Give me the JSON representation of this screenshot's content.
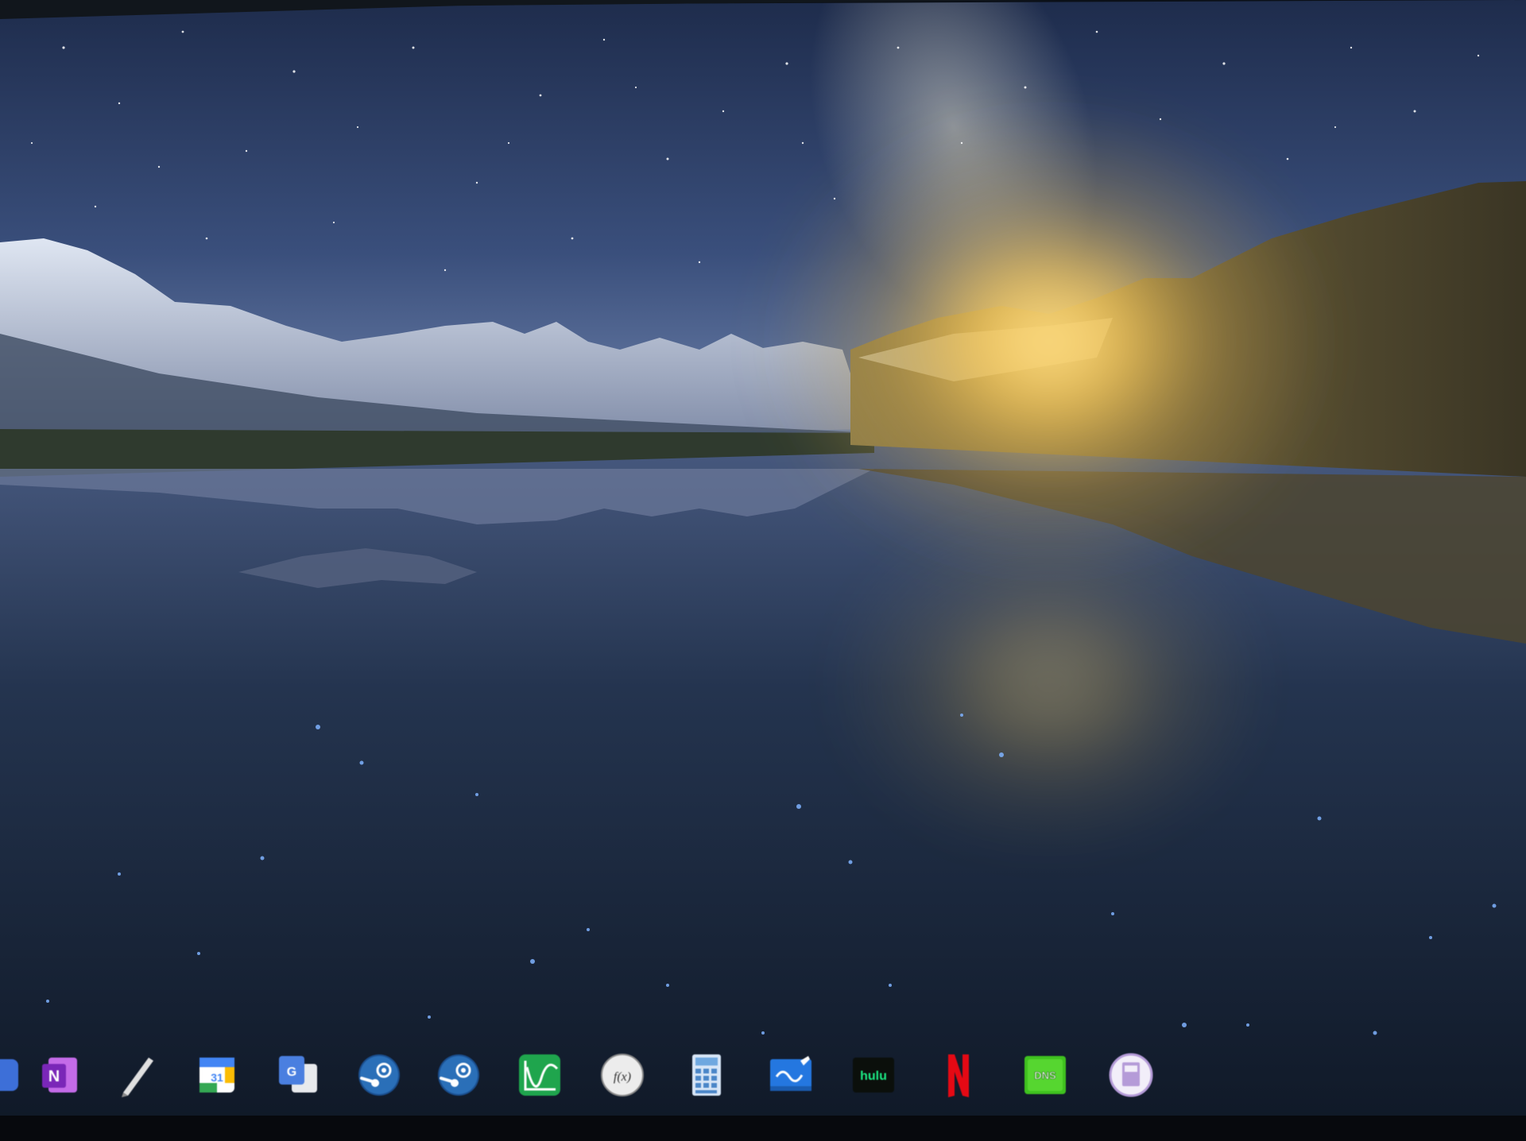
{
  "desktop": {
    "wallpaper": {
      "description_icon": "starry-mountain-lake-wallpaper",
      "colors": {
        "sky_top": "#2a3a5e",
        "sky_horizon": "#6b80a8",
        "glow": "#f3c65a",
        "water": "#1a2738"
      }
    }
  },
  "dock": {
    "items": [
      {
        "id": "partial",
        "icon": "app-icon-partial",
        "color": "#3d6fd8"
      },
      {
        "id": "onenote",
        "icon": "onenote-icon",
        "color": "#9b3fd4",
        "glyph": "N"
      },
      {
        "id": "pen",
        "icon": "pen-icon",
        "color": "#d8d8d8"
      },
      {
        "id": "calendar",
        "icon": "google-calendar-icon",
        "color": "#4285f4",
        "glyph": "31"
      },
      {
        "id": "translate",
        "icon": "google-translate-icon",
        "color": "#4a7fe0",
        "glyph": "G"
      },
      {
        "id": "steam-1",
        "icon": "steam-icon",
        "color": "#2a6fb8"
      },
      {
        "id": "steam-2",
        "icon": "steam-icon",
        "color": "#2a6fb8"
      },
      {
        "id": "grapher",
        "icon": "graphing-icon",
        "color": "#1fa54d"
      },
      {
        "id": "formula",
        "icon": "function-icon",
        "color": "#e8e8e8",
        "glyph": "f(x)"
      },
      {
        "id": "calculator",
        "icon": "calculator-icon",
        "color": "#6fa8e0"
      },
      {
        "id": "whiteboard",
        "icon": "whiteboard-icon",
        "color": "#2477e0"
      },
      {
        "id": "hulu",
        "icon": "hulu-icon",
        "color": "#1ce783",
        "glyph": "hulu"
      },
      {
        "id": "netflix",
        "icon": "netflix-icon",
        "color": "#e50914",
        "glyph": "N"
      },
      {
        "id": "dns",
        "icon": "dns-icon",
        "color": "#3fc11f",
        "glyph": "DNS"
      },
      {
        "id": "notes",
        "icon": "notes-icon",
        "color": "#b59bd8"
      }
    ]
  }
}
